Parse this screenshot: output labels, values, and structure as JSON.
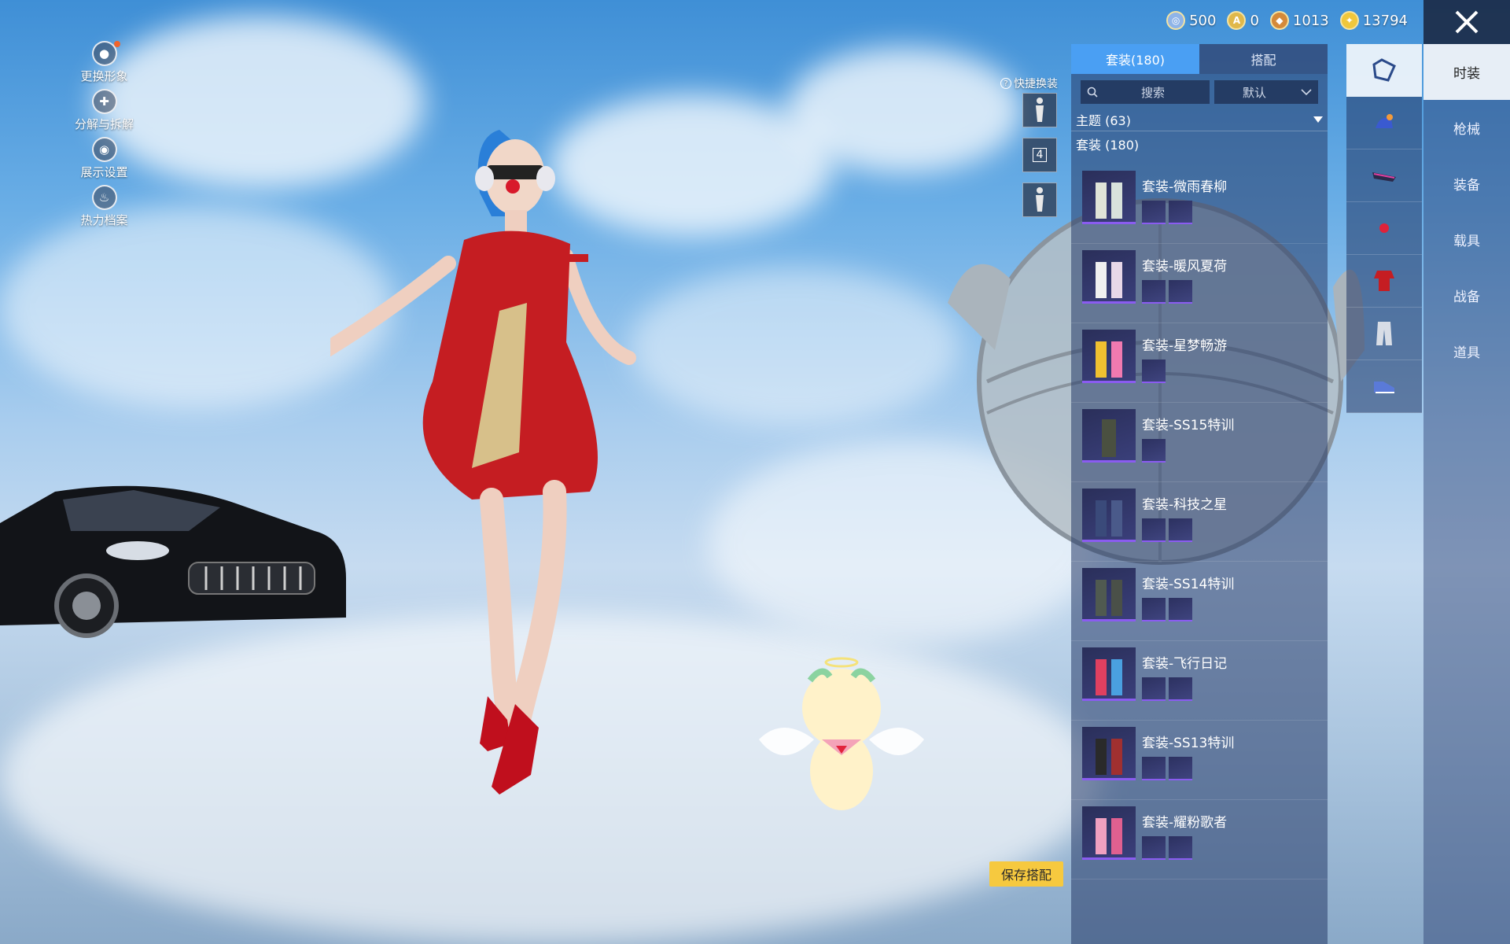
{
  "left_actions": [
    {
      "label": "更换形象",
      "icon": "avatar-icon"
    },
    {
      "label": "分解与拆解",
      "icon": "dismantle-icon"
    },
    {
      "label": "展示设置",
      "icon": "eye-icon"
    },
    {
      "label": "热力档案",
      "icon": "flame-icon"
    }
  ],
  "currency": [
    {
      "value": "500",
      "icon": "globe-coin-icon",
      "color": "#8fb4e8"
    },
    {
      "value": "0",
      "icon": "a-coin-icon",
      "color": "#e0b84a"
    },
    {
      "value": "1013",
      "icon": "medal-coin-icon",
      "color": "#d48a3a"
    },
    {
      "value": "13794",
      "icon": "gold-coin-icon",
      "color": "#f0c73c"
    }
  ],
  "categories": [
    "时装",
    "枪械",
    "装备",
    "载具",
    "战备",
    "道具"
  ],
  "sub_icons": [
    "outfit-set-icon",
    "hat-icon",
    "glasses-icon",
    "mask-icon",
    "top-icon",
    "pants-icon",
    "shoes-icon"
  ],
  "panel": {
    "tabs": [
      "套装(180)",
      "搭配"
    ],
    "search_placeholder": "搜索",
    "sort": "默认",
    "filter": "主题 (63)",
    "subtitle": "套装 (180)"
  },
  "outfits": [
    {
      "name": "套装-微雨春柳",
      "parts": 2
    },
    {
      "name": "套装-暖风夏荷",
      "parts": 2
    },
    {
      "name": "套装-星梦畅游",
      "parts": 1
    },
    {
      "name": "套装-SS15特训",
      "parts": 1
    },
    {
      "name": "套装-科技之星",
      "parts": 2
    },
    {
      "name": "套装-SS14特训",
      "parts": 2
    },
    {
      "name": "套装-飞行日记",
      "parts": 2
    },
    {
      "name": "套装-SS13特训",
      "parts": 2
    },
    {
      "name": "套装-耀粉歌者",
      "parts": 2
    }
  ],
  "quick_change": {
    "label": "快捷换装",
    "slot_2_number": "4"
  },
  "save_button": "保存搭配",
  "colors": {
    "accent": "#4a9ff3",
    "save": "#f6c93f",
    "rarity": "#8a5cf0",
    "dress": "#c51d22"
  }
}
